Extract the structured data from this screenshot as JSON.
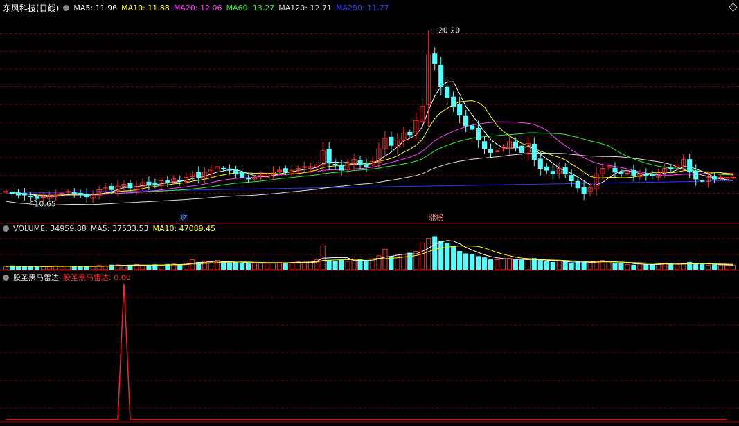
{
  "header": {
    "stock_name": "东风科技(日线)",
    "ma_items": [
      {
        "label": "MA5: 11.96",
        "color": "#ffffff"
      },
      {
        "label": "MA10: 11.88",
        "color": "#ffff00"
      },
      {
        "label": "MA20: 12.06",
        "color": "#ff44ff"
      },
      {
        "label": "MA60: 13.27",
        "color": "#33ee33"
      },
      {
        "label": "MA120: 12.71",
        "color": "#dddddd"
      },
      {
        "label": "MA250: 11.77",
        "color": "#3333ff"
      }
    ]
  },
  "volume_header": {
    "items": [
      {
        "label": "VOLUME: 34959.88",
        "color": "#dddddd"
      },
      {
        "label": "MA5: 37533.53",
        "color": "#dddddd"
      },
      {
        "label": "MA10: 47089.45",
        "color": "#ffff00"
      }
    ]
  },
  "indicator_header": {
    "name": "股圣黑马雷达",
    "value_label": "股圣黑马雷达: 0.00",
    "value_color": "#ff3333"
  },
  "markers": {
    "high_label": "20.20",
    "low_label": "10.65",
    "tag_finance": "财",
    "tag_limit": "涨榜"
  },
  "colors": {
    "up": "#ff3333",
    "down": "#54ffff",
    "grid": "#7a0000",
    "separator": "#b00000"
  },
  "chart_data": {
    "type": "candlestick",
    "price_high": 20.2,
    "price_low": 10.65,
    "closes": [
      11.1,
      11.0,
      10.9,
      10.9,
      10.8,
      10.7,
      10.8,
      10.9,
      10.9,
      11.0,
      11.1,
      11.0,
      10.9,
      10.8,
      10.9,
      11.2,
      11.3,
      11.2,
      11.4,
      11.5,
      11.3,
      11.4,
      11.6,
      11.5,
      11.5,
      11.7,
      11.6,
      11.8,
      11.7,
      11.9,
      12.1,
      11.9,
      12.2,
      12.3,
      12.5,
      12.4,
      12.3,
      12.1,
      11.9,
      11.8,
      11.9,
      12.0,
      12.1,
      12.2,
      12.3,
      12.2,
      12.3,
      12.4,
      12.5,
      12.5,
      12.6,
      13.4,
      12.7,
      12.6,
      12.3,
      12.7,
      12.9,
      12.6,
      12.5,
      12.8,
      13.5,
      14.1,
      13.7,
      14.0,
      14.4,
      14.3,
      15.1,
      15.9,
      18.8,
      18.3,
      17.0,
      16.4,
      15.9,
      15.4,
      14.8,
      14.6,
      14.0,
      13.5,
      13.3,
      13.4,
      13.6,
      13.9,
      13.6,
      13.3,
      13.8,
      12.9,
      12.4,
      12.3,
      12.1,
      12.4,
      12.1,
      11.7,
      11.3,
      11.0,
      11.3,
      12.1,
      12.4,
      12.5,
      12.2,
      12.1,
      12.2,
      12.0,
      12.1,
      12.0,
      12.0,
      12.2,
      12.4,
      12.4,
      12.6,
      12.9,
      12.2,
      11.8,
      11.7,
      11.9,
      11.8,
      11.9,
      11.9,
      11.9
    ],
    "volumes": [
      0.1,
      0.12,
      0.1,
      0.09,
      0.1,
      0.11,
      0.1,
      0.1,
      0.12,
      0.1,
      0.11,
      0.1,
      0.09,
      0.1,
      0.11,
      0.13,
      0.12,
      0.14,
      0.15,
      0.13,
      0.14,
      0.16,
      0.12,
      0.14,
      0.15,
      0.14,
      0.16,
      0.18,
      0.15,
      0.2,
      0.3,
      0.22,
      0.26,
      0.22,
      0.28,
      0.24,
      0.2,
      0.22,
      0.2,
      0.18,
      0.2,
      0.19,
      0.21,
      0.2,
      0.22,
      0.21,
      0.22,
      0.24,
      0.22,
      0.26,
      0.3,
      0.72,
      0.28,
      0.26,
      0.28,
      0.25,
      0.32,
      0.3,
      0.26,
      0.32,
      0.42,
      0.62,
      0.4,
      0.44,
      0.46,
      0.5,
      0.55,
      0.8,
      0.95,
      1.0,
      0.86,
      0.8,
      0.7,
      0.55,
      0.48,
      0.45,
      0.4,
      0.36,
      0.3,
      0.3,
      0.32,
      0.34,
      0.3,
      0.28,
      0.3,
      0.34,
      0.28,
      0.24,
      0.22,
      0.26,
      0.24,
      0.2,
      0.24,
      0.22,
      0.2,
      0.26,
      0.28,
      0.24,
      0.2,
      0.18,
      0.16,
      0.14,
      0.18,
      0.16,
      0.15,
      0.16,
      0.2,
      0.18,
      0.16,
      0.2,
      0.22,
      0.18,
      0.16,
      0.14,
      0.15,
      0.14,
      0.14,
      0.14
    ],
    "indicator": {
      "values": [
        0,
        0,
        0,
        0,
        0,
        0,
        0,
        0,
        0,
        0,
        0,
        0,
        0,
        0,
        0,
        0,
        0,
        0,
        0,
        1,
        0,
        0,
        0,
        0,
        0,
        0,
        0,
        0,
        0,
        0,
        0,
        0,
        0,
        0,
        0,
        0,
        0,
        0,
        0,
        0,
        0,
        0,
        0,
        0,
        0,
        0,
        0,
        0,
        0,
        0,
        0,
        0,
        0,
        0,
        0,
        0,
        0,
        0,
        0,
        0,
        0,
        0,
        0,
        0,
        0,
        0,
        0,
        0,
        0,
        0,
        0,
        0,
        0,
        0,
        0,
        0,
        0,
        0,
        0,
        0,
        0,
        0,
        0,
        0,
        0,
        0,
        0,
        0,
        0,
        0,
        0,
        0,
        0,
        0,
        0,
        0,
        0,
        0,
        0,
        0,
        0,
        0,
        0,
        0,
        0,
        0,
        0,
        0,
        0,
        0,
        0,
        0,
        0,
        0,
        0,
        0,
        0
      ]
    }
  }
}
